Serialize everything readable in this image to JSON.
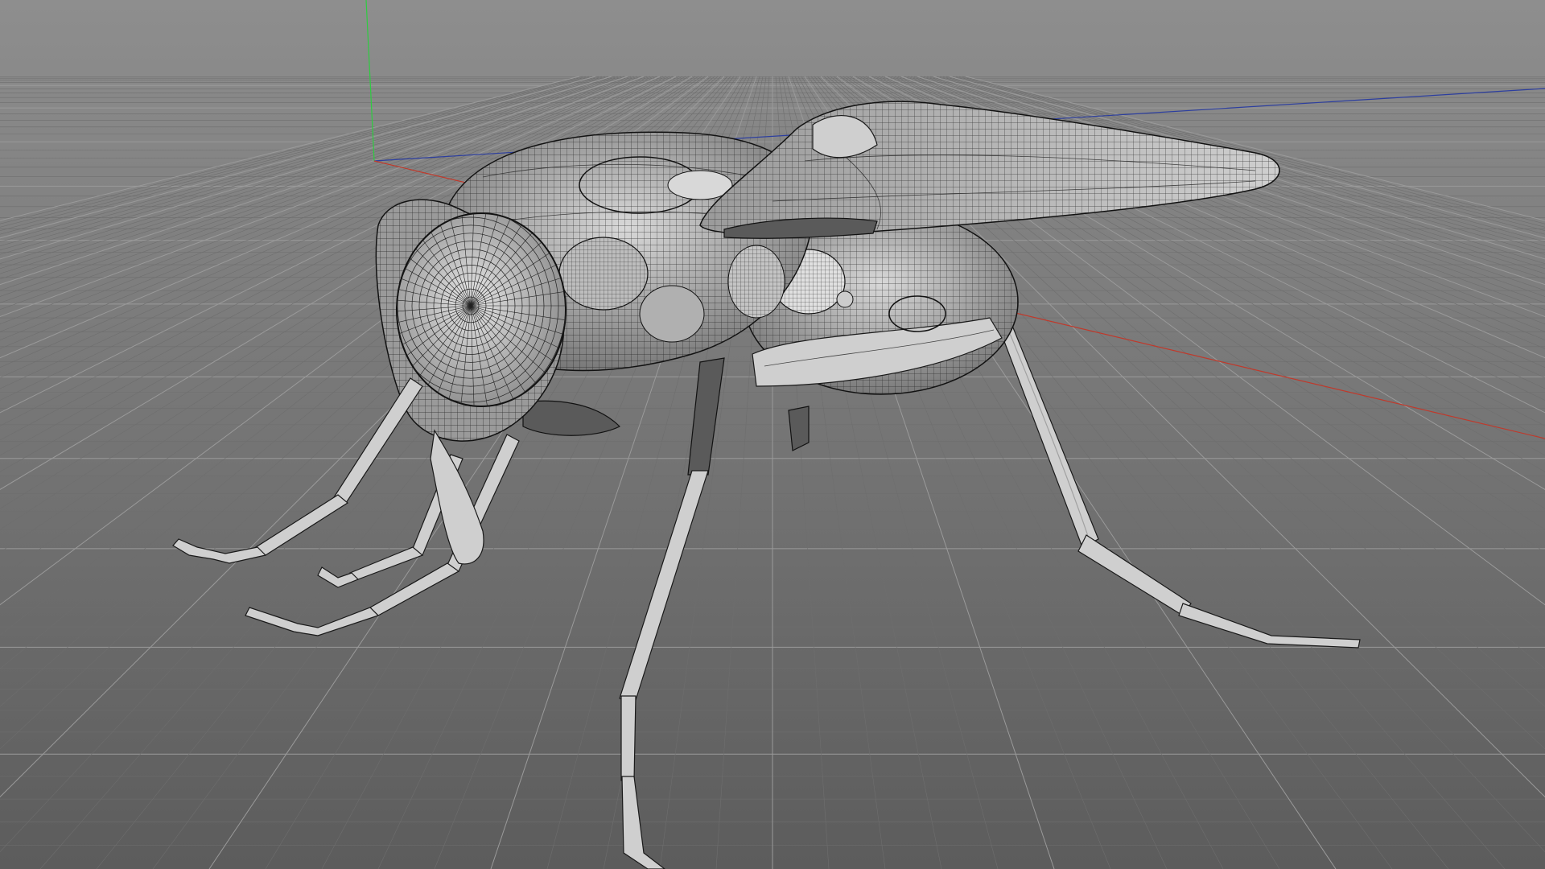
{
  "viewport": {
    "background_top": "#8e8e8e",
    "background_bottom": "#5c5c5c",
    "grid_color": "#9a9a9a",
    "grid_minor_color": "#6e6e6e",
    "axis_colors": {
      "x": "#c0392b",
      "y": "#2ecc40",
      "z": "#2c3e9f"
    }
  },
  "model": {
    "subject": "fly-wireframe",
    "display_mode": "wireframe-shaded"
  }
}
